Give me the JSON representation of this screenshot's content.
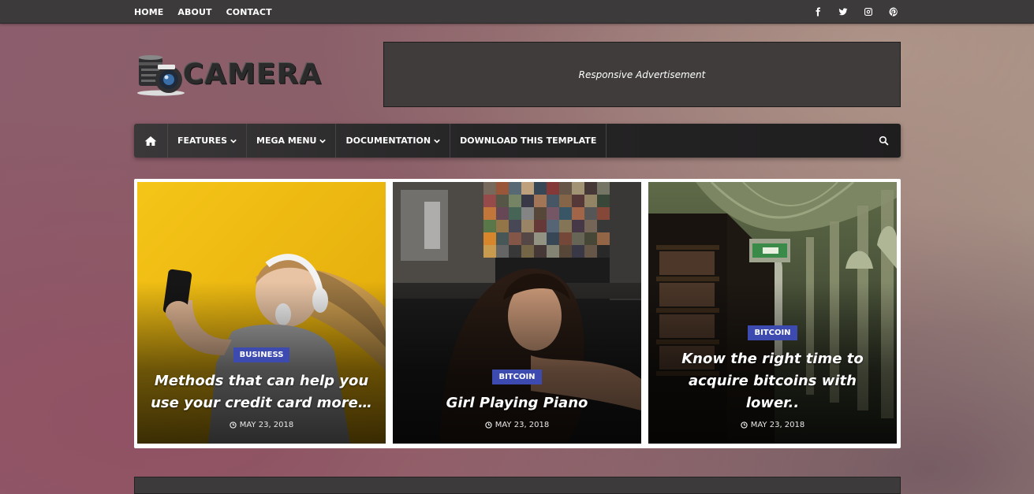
{
  "topbar": {
    "links": [
      "HOME",
      "ABOUT",
      "CONTACT"
    ],
    "social_icons": [
      "facebook-icon",
      "twitter-icon",
      "instagram-icon",
      "pinterest-icon"
    ]
  },
  "header": {
    "logo_text": "CAMERA",
    "ad_text": "Responsive Advertisement"
  },
  "mainnav": {
    "items": [
      "FEATURES",
      "MEGA MENU",
      "DOCUMENTATION",
      "DOWNLOAD THIS TEMPLATE"
    ]
  },
  "featured": {
    "posts": [
      {
        "category": "BUSINESS",
        "title": "Methods that can help you use your credit card more…",
        "date": "MAY 23, 2018"
      },
      {
        "category": "BITCOIN",
        "title": "Girl Playing Piano",
        "date": "MAY 23, 2018"
      },
      {
        "category": "BITCOIN",
        "title": "Know the right time to acquire bitcoins with lower..",
        "date": "MAY 23, 2018"
      }
    ]
  },
  "colors": {
    "badge": "#3d4bb0",
    "topbar": "#3c3a3b",
    "nav": "#262526"
  }
}
